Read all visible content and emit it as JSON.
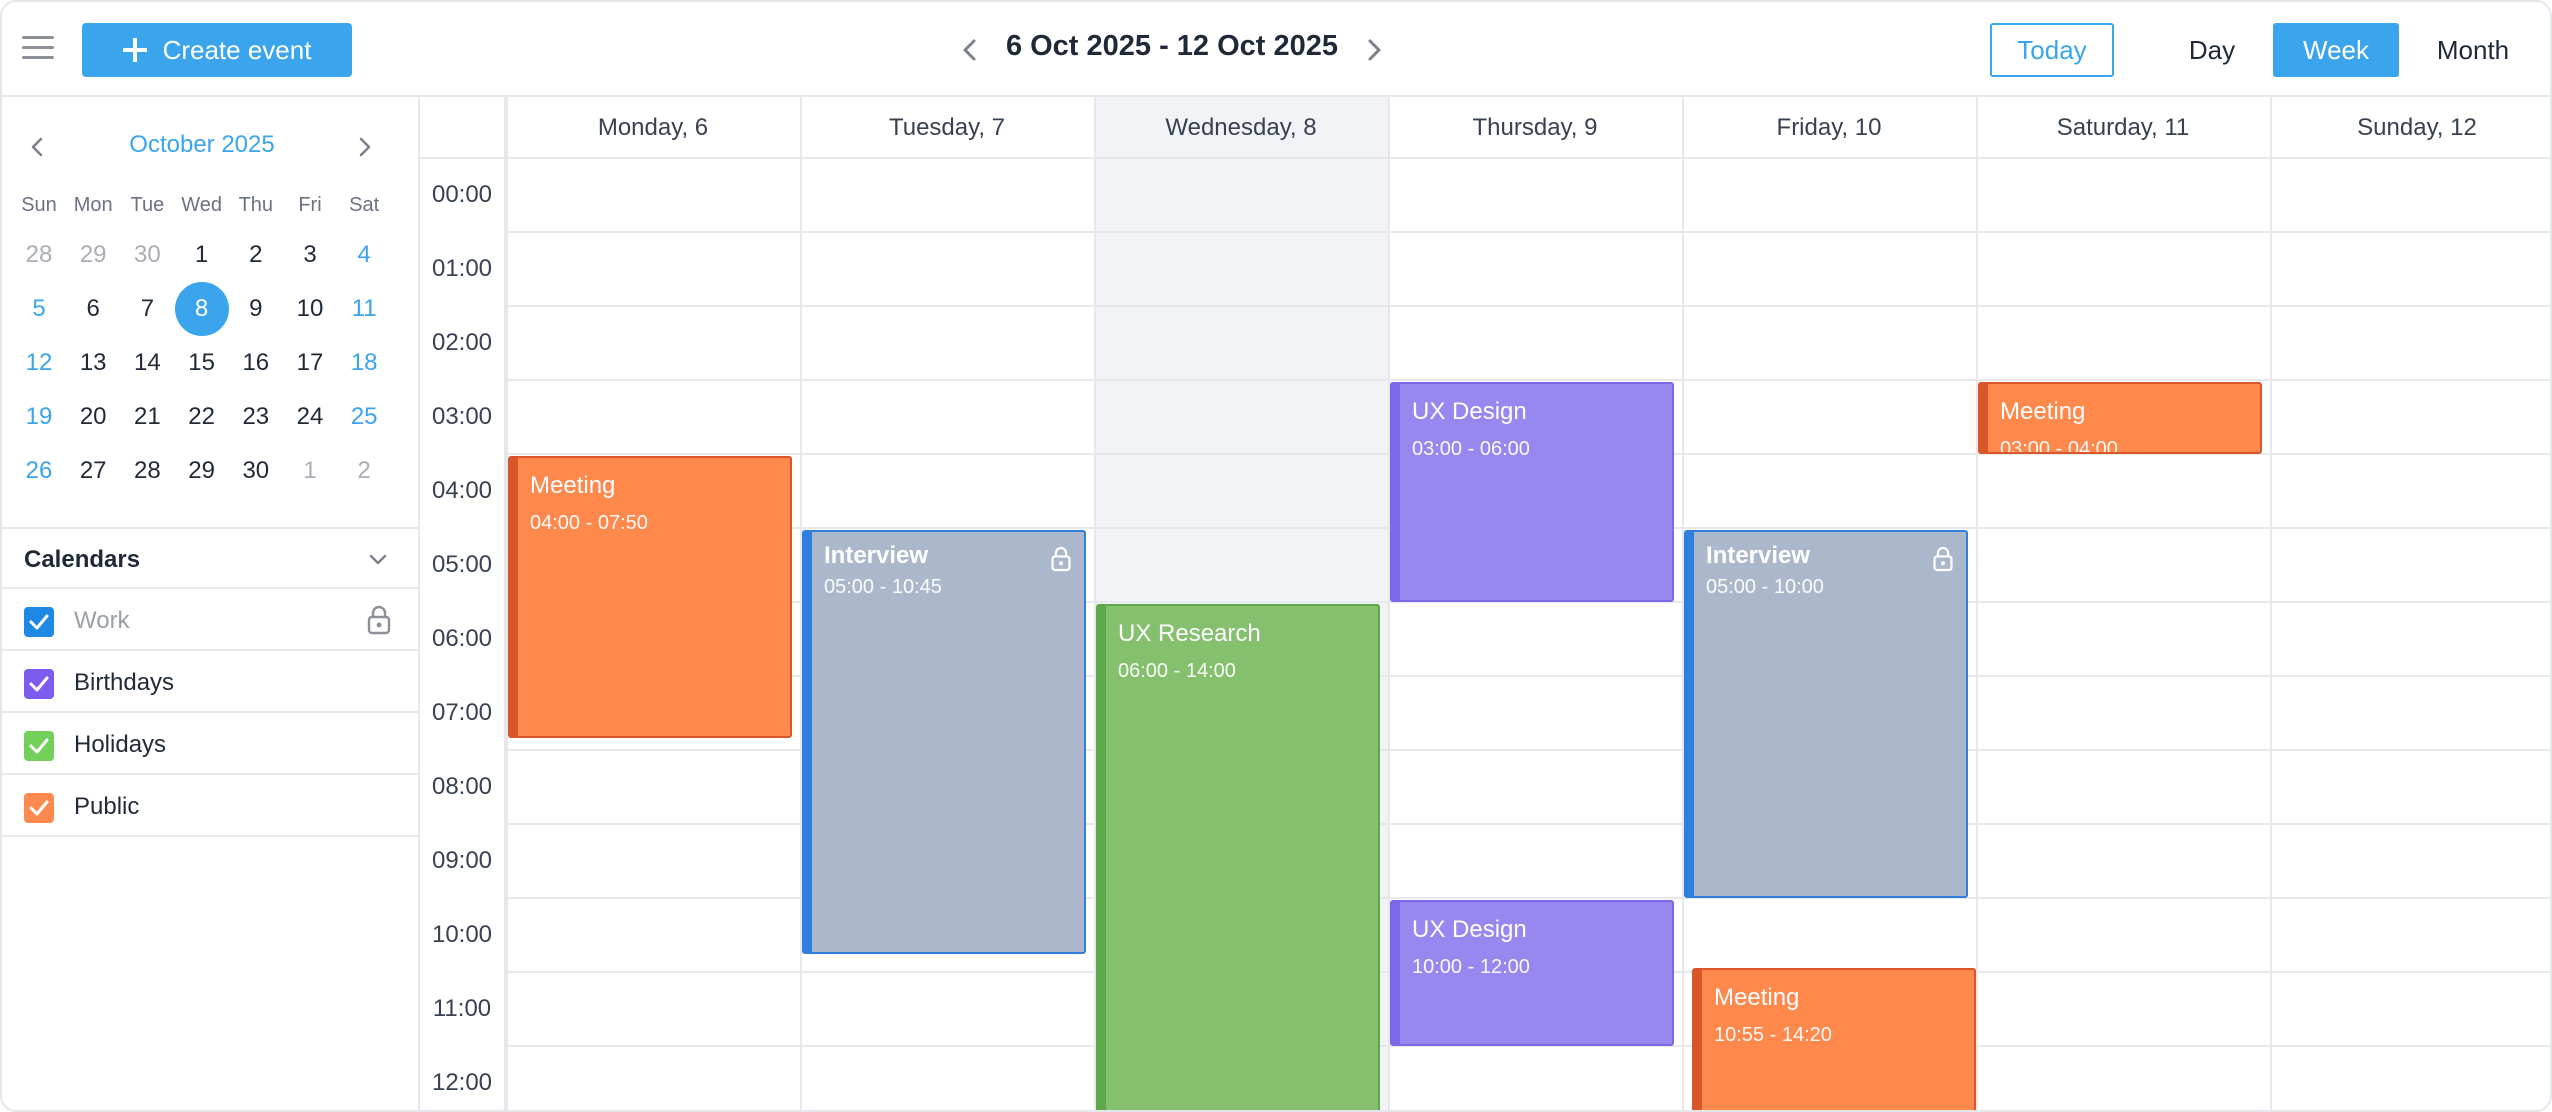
{
  "toolbar": {
    "create_label": "Create event",
    "range_title": "6 Oct 2025 - 12 Oct 2025",
    "today_label": "Today",
    "views": [
      "Day",
      "Week",
      "Month"
    ],
    "active_view": "Week"
  },
  "mini_calendar": {
    "title": "October 2025",
    "weekdays": [
      "Sun",
      "Mon",
      "Tue",
      "Wed",
      "Thu",
      "Fri",
      "Sat"
    ],
    "weeks": [
      [
        "28",
        "29",
        "30",
        "1",
        "2",
        "3",
        "4"
      ],
      [
        "5",
        "6",
        "7",
        "8",
        "9",
        "10",
        "11"
      ],
      [
        "12",
        "13",
        "14",
        "15",
        "16",
        "17",
        "18"
      ],
      [
        "19",
        "20",
        "21",
        "22",
        "23",
        "24",
        "25"
      ],
      [
        "26",
        "27",
        "28",
        "29",
        "30",
        "1",
        "2"
      ]
    ],
    "selected_day": "8"
  },
  "calendars": {
    "title": "Calendars",
    "items": [
      {
        "label": "Work",
        "color": "#1e88e5",
        "locked": true
      },
      {
        "label": "Birthdays",
        "color": "#7e5bef"
      },
      {
        "label": "Holidays",
        "color": "#72d05a"
      },
      {
        "label": "Public",
        "color": "#ff8a50"
      }
    ]
  },
  "week": {
    "days": [
      "Monday, 6",
      "Tuesday, 7",
      "Wednesday, 8",
      "Thursday, 9",
      "Friday, 10",
      "Saturday, 11",
      "Sunday, 12"
    ],
    "today_index": 2,
    "hours": [
      "00:00",
      "01:00",
      "02:00",
      "03:00",
      "04:00",
      "05:00",
      "06:00",
      "07:00",
      "08:00",
      "09:00",
      "10:00",
      "11:00",
      "12:00"
    ]
  },
  "events": [
    {
      "title": "Meeting",
      "time": "04:00 - 07:50",
      "day": 0,
      "calendar": "Public"
    },
    {
      "title": "Interview",
      "time": "05:00 - 10:45",
      "day": 1,
      "calendar": "Work",
      "locked": true
    },
    {
      "title": "UX Research",
      "time": "06:00 - 14:00",
      "day": 2,
      "calendar": "Holidays"
    },
    {
      "title": "UX Design",
      "time": "03:00 - 06:00",
      "day": 3,
      "calendar": "Birthdays"
    },
    {
      "title": "UX Design",
      "time": "10:00 - 12:00",
      "day": 3,
      "calendar": "Birthdays"
    },
    {
      "title": "Interview",
      "time": "05:00 - 10:00",
      "day": 4,
      "calendar": "Work",
      "locked": true
    },
    {
      "title": "Meeting",
      "time": "10:55 - 14:20",
      "day": 4,
      "calendar": "Public"
    },
    {
      "title": "Meeting",
      "time": "03:00 - 04:00",
      "day": 5,
      "calendar": "Public"
    }
  ],
  "colors": {
    "accent": "#3aa4ec",
    "public_fill": "#ff884d",
    "public_bar": "#d9552a",
    "work_fill": "#abb8cb",
    "work_bar": "#2f7fdc",
    "holiday_fill": "#84c06e",
    "holiday_bar": "#5fa84a",
    "birthday_fill": "#9688ef",
    "birthday_bar": "#7a68e8"
  }
}
